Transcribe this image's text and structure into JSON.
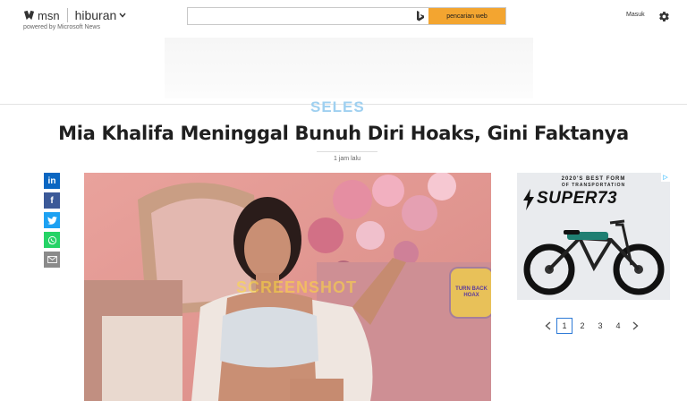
{
  "header": {
    "logo_text": "msn",
    "section": "hiburan",
    "powered_by": "powered by Microsoft News",
    "search": {
      "value": "",
      "button_label": "pencarian web"
    },
    "signin_label": "Masuk"
  },
  "article": {
    "source_logo_text": "SELES",
    "title": "Mia Khalifa Meninggal Bunuh Diri Hoaks, Gini Faktanya",
    "time_label": "1 jam lalu",
    "share_buttons": [
      {
        "icon": "linkedin-icon",
        "glyph": "in",
        "color": "#0a66c2"
      },
      {
        "icon": "facebook-icon",
        "glyph": "f",
        "color": "#3b5998"
      },
      {
        "icon": "twitter-icon",
        "glyph": "t",
        "color": "#1da1f2"
      },
      {
        "icon": "whatsapp-icon",
        "glyph": "w",
        "color": "#25d366"
      },
      {
        "icon": "email-icon",
        "glyph": "✉",
        "color": "#8a8a8a"
      }
    ],
    "photo_watermark": "SCREENSHOT",
    "photo_seal_text": "TURN BACK HOAX"
  },
  "ad": {
    "headline_1": "2020'S BEST FORM",
    "headline_2": "OF TRANSPORTATION",
    "brand": "SUPER73"
  },
  "pager": {
    "pages": [
      "1",
      "2",
      "3",
      "4"
    ],
    "active": "1"
  }
}
